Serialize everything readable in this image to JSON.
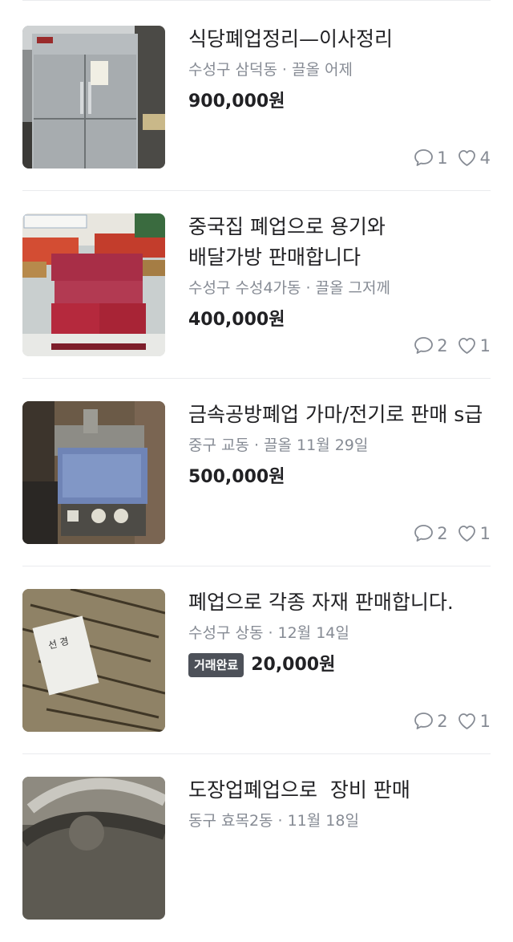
{
  "items": [
    {
      "title": "식당폐업정리—이사정리",
      "location": "수성구 삼덕동",
      "time": "끌올 어제",
      "price": "900,000원",
      "badge": "",
      "comments": "1",
      "likes": "4"
    },
    {
      "title": "중국집 폐업으로 용기와 배달가방 판매합니다",
      "location": "수성구 수성4가동",
      "time": "끌올 그저께",
      "price": "400,000원",
      "badge": "",
      "comments": "2",
      "likes": "1"
    },
    {
      "title": "금속공방폐업 가마/전기로 판매 s급",
      "location": "중구 교동",
      "time": "끌올 11월 29일",
      "price": "500,000원",
      "badge": "",
      "comments": "2",
      "likes": "1"
    },
    {
      "title": "폐업으로 각종 자재 판매합니다.",
      "location": "수성구 상동",
      "time": "12월 14일",
      "price": "20,000원",
      "badge": "거래완료",
      "comments": "2",
      "likes": "1"
    },
    {
      "title": "도장업폐업으로  장비 판매",
      "location": "동구 효목2동",
      "time": "11월 18일",
      "price": "",
      "badge": "",
      "comments": "",
      "likes": ""
    }
  ],
  "icons": {
    "comment": "chat-bubble-icon",
    "like": "heart-icon"
  },
  "colors": {
    "text": "#212124",
    "muted": "#868b94",
    "divider": "#eaebee",
    "badge": "#4d5159"
  }
}
